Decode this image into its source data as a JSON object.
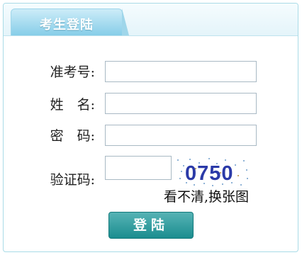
{
  "header": {
    "title": "考生登陆"
  },
  "form": {
    "ticket_label": "准考号:",
    "name_label": "姓　名:",
    "password_label": "密　码:",
    "captcha_label": "验证码:",
    "ticket_value": "",
    "name_value": "",
    "password_value": "",
    "captcha_value": ""
  },
  "captcha": {
    "code": "0750",
    "refresh_text": "看不清,换张图"
  },
  "actions": {
    "login_label": "登陆"
  },
  "colors": {
    "accent": "#1b8d8f",
    "header": "#86cde8",
    "captcha_text": "#2b3aa8"
  }
}
